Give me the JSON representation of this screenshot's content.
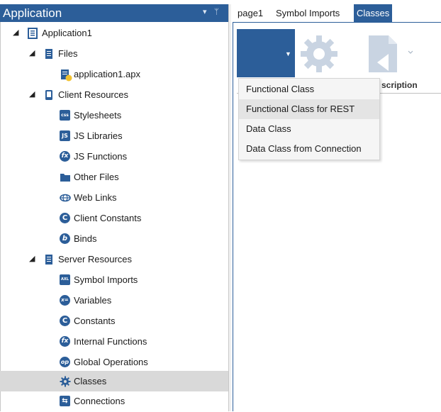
{
  "panel": {
    "title": "Application",
    "pin_glyph": "▾",
    "pin2_glyph": "ᛘ"
  },
  "tree": {
    "root": {
      "label": "Application1",
      "icon": "application-icon"
    },
    "files": {
      "label": "Files",
      "icon": "files-icon"
    },
    "application_file": {
      "label": "application1.apx",
      "icon": "apx-file-icon"
    },
    "client_resources": {
      "label": "Client Resources",
      "icon": "client-resources-icon"
    },
    "client_items": [
      {
        "label": "Stylesheets",
        "icon": "css-icon",
        "glyph": "css"
      },
      {
        "label": "JS Libraries",
        "icon": "js-icon",
        "glyph": "JS"
      },
      {
        "label": "JS Functions",
        "icon": "fx-icon",
        "glyph": "fx"
      },
      {
        "label": "Other Files",
        "icon": "folder-icon",
        "glyph": ""
      },
      {
        "label": "Web Links",
        "icon": "web-link-icon",
        "glyph": "⊕"
      },
      {
        "label": "Client Constants",
        "icon": "constant-icon",
        "glyph": "C"
      },
      {
        "label": "Binds",
        "icon": "bind-icon",
        "glyph": "b"
      }
    ],
    "server_resources": {
      "label": "Server Resources",
      "icon": "server-resources-icon"
    },
    "server_items": [
      {
        "label": "Symbol Imports",
        "icon": "symbol-import-icon",
        "glyph": "AXL"
      },
      {
        "label": "Variables",
        "icon": "variable-icon",
        "glyph": "x="
      },
      {
        "label": "Constants",
        "icon": "constant-icon",
        "glyph": "C"
      },
      {
        "label": "Internal Functions",
        "icon": "fx-icon",
        "glyph": "fx"
      },
      {
        "label": "Global Operations",
        "icon": "operation-icon",
        "glyph": "op"
      },
      {
        "label": "Classes",
        "icon": "gear-icon",
        "glyph": "⚙"
      },
      {
        "label": "Connections",
        "icon": "connection-icon",
        "glyph": "⇆"
      }
    ],
    "selected_label": "Classes"
  },
  "tabs": [
    {
      "label": "page1"
    },
    {
      "label": "Symbol Imports"
    },
    {
      "label": "Classes"
    }
  ],
  "grid": {
    "description_header": "scription"
  },
  "menu": {
    "items": [
      {
        "label": "Functional Class"
      },
      {
        "label": "Functional Class for REST"
      },
      {
        "label": "Data Class"
      },
      {
        "label": "Data Class from Connection"
      }
    ],
    "hovered_index": 1
  },
  "colors": {
    "accent": "#2c5e99",
    "selected_row": "#d9d9d9",
    "disabled_icon": "#c9d4e2"
  }
}
